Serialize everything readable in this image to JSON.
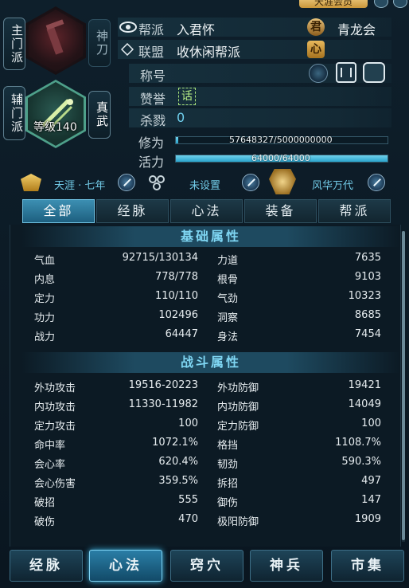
{
  "sects": {
    "primary_label": "主门派",
    "primary_sect": "神刀",
    "secondary_label": "辅门派",
    "secondary_sect": "真武",
    "level": "等级140"
  },
  "top_button": "天涯会员",
  "guild": {
    "key": "帮派",
    "value": "入君怀",
    "badge": "君",
    "league_name": "青龙会"
  },
  "alliance": {
    "key": "联盟",
    "value": "收休闲帮派",
    "badge": "心"
  },
  "title_row": {
    "key": "称号"
  },
  "praise": {
    "key": "赞誉",
    "badge": "话"
  },
  "kills": {
    "key": "杀戮",
    "value": "0"
  },
  "cultivation": {
    "key": "修为",
    "text": "57648327/5000000000",
    "fraction": 0.0115
  },
  "vitality": {
    "key": "活力",
    "text": "64000/64000",
    "fraction": 1.0
  },
  "sect_row": {
    "item1": "天涯 · 七年",
    "item2": "未设置",
    "item3": "风华万代"
  },
  "tabs": [
    "全部",
    "经脉",
    "心法",
    "装备",
    "帮派"
  ],
  "basic": {
    "title": "基础属性",
    "rows": [
      [
        "气血",
        "92715/130134",
        "力道",
        "7635"
      ],
      [
        "内息",
        "778/778",
        "根骨",
        "9103"
      ],
      [
        "定力",
        "110/110",
        "气劲",
        "10323"
      ],
      [
        "功力",
        "102496",
        "洞察",
        "8685"
      ],
      [
        "战力",
        "64447",
        "身法",
        "7454"
      ]
    ]
  },
  "combat": {
    "title": "战斗属性",
    "rows": [
      [
        "外功攻击",
        "19516-20223",
        "外功防御",
        "19421"
      ],
      [
        "内功攻击",
        "11330-11982",
        "内功防御",
        "14049"
      ],
      [
        "定力攻击",
        "100",
        "定力防御",
        "100"
      ],
      [
        "命中率",
        "1072.1%",
        "格挡",
        "1108.7%"
      ],
      [
        "会心率",
        "620.4%",
        "韧劲",
        "590.3%"
      ],
      [
        "会心伤害",
        "359.5%",
        "拆招",
        "497"
      ],
      [
        "破招",
        "555",
        "御伤",
        "147"
      ],
      [
        "破伤",
        "470",
        "极阳防御",
        "1909"
      ]
    ]
  },
  "bottom_nav": [
    "经脉",
    "心法",
    "窍穴",
    "神兵",
    "市集"
  ],
  "colors": {
    "accent": "#7fd6f3",
    "gold": "#e9b95c",
    "bg": "#0b1822"
  }
}
